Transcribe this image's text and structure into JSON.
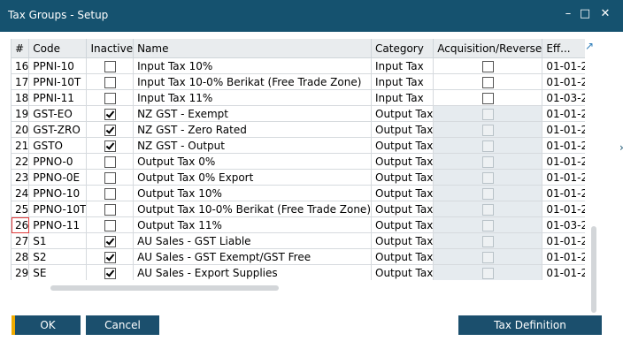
{
  "window": {
    "title": "Tax Groups - Setup",
    "controls": {
      "minimize": "–",
      "maximize": "□",
      "close": "✕"
    }
  },
  "table": {
    "columns": [
      "#",
      "Code",
      "Inactive",
      "Name",
      "Category",
      "Acquisition/Reverse",
      "Eff..."
    ],
    "rows": [
      {
        "num": "16",
        "code": "PPNI-10",
        "inactive": false,
        "name": "Input Tax 10%",
        "category": "Input Tax",
        "acq": false,
        "acq_disabled": false,
        "eff": "01-01-2"
      },
      {
        "num": "17",
        "code": "PPNI-10T",
        "inactive": false,
        "name": "Input Tax 10-0% Berikat (Free Trade Zone)",
        "category": "Input Tax",
        "acq": false,
        "acq_disabled": false,
        "eff": "01-01-2"
      },
      {
        "num": "18",
        "code": "PPNI-11",
        "inactive": false,
        "name": "Input Tax 11%",
        "category": "Input Tax",
        "acq": false,
        "acq_disabled": false,
        "eff": "01-03-2"
      },
      {
        "num": "19",
        "code": "GST-EO",
        "inactive": true,
        "name": "NZ GST - Exempt",
        "category": "Output Tax",
        "acq": false,
        "acq_disabled": true,
        "eff": "01-01-2"
      },
      {
        "num": "20",
        "code": "GST-ZRO",
        "inactive": true,
        "name": "NZ GST - Zero Rated",
        "category": "Output Tax",
        "acq": false,
        "acq_disabled": true,
        "eff": "01-01-2"
      },
      {
        "num": "21",
        "code": "GSTO",
        "inactive": true,
        "name": "NZ GST - Output",
        "category": "Output Tax",
        "acq": false,
        "acq_disabled": true,
        "eff": "01-01-2"
      },
      {
        "num": "22",
        "code": "PPNO-0",
        "inactive": false,
        "name": "Output Tax 0%",
        "category": "Output Tax",
        "acq": false,
        "acq_disabled": true,
        "eff": "01-01-2"
      },
      {
        "num": "23",
        "code": "PPNO-0E",
        "inactive": false,
        "name": "Output Tax 0% Export",
        "category": "Output Tax",
        "acq": false,
        "acq_disabled": true,
        "eff": "01-01-2"
      },
      {
        "num": "24",
        "code": "PPNO-10",
        "inactive": false,
        "name": "Output Tax 10%",
        "category": "Output Tax",
        "acq": false,
        "acq_disabled": true,
        "eff": "01-01-2"
      },
      {
        "num": "25",
        "code": "PPNO-10T",
        "inactive": false,
        "name": "Output Tax 10-0% Berikat (Free Trade Zone)",
        "category": "Output Tax",
        "acq": false,
        "acq_disabled": true,
        "eff": "01-01-2"
      },
      {
        "num": "26",
        "code": "PPNO-11",
        "inactive": false,
        "name": "Output Tax 11%",
        "category": "Output Tax",
        "acq": false,
        "acq_disabled": true,
        "eff": "01-03-2"
      },
      {
        "num": "27",
        "code": "S1",
        "inactive": true,
        "name": "AU Sales - GST Liable",
        "category": "Output Tax",
        "acq": false,
        "acq_disabled": true,
        "eff": "01-01-2"
      },
      {
        "num": "28",
        "code": "S2",
        "inactive": true,
        "name": "AU Sales - GST Exempt/GST Free",
        "category": "Output Tax",
        "acq": false,
        "acq_disabled": true,
        "eff": "01-01-2"
      },
      {
        "num": "29",
        "code": "SE",
        "inactive": true,
        "name": "AU Sales - Export Supplies",
        "category": "Output Tax",
        "acq": false,
        "acq_disabled": true,
        "eff": "01-01-2"
      }
    ]
  },
  "buttons": {
    "ok": "OK",
    "cancel": "Cancel",
    "tax_definition": "Tax Definition"
  },
  "colors": {
    "titlebar": "#15526f",
    "button": "#1b4f6d",
    "ok_accent": "#f0ab00",
    "selection": "#e03b3b"
  }
}
